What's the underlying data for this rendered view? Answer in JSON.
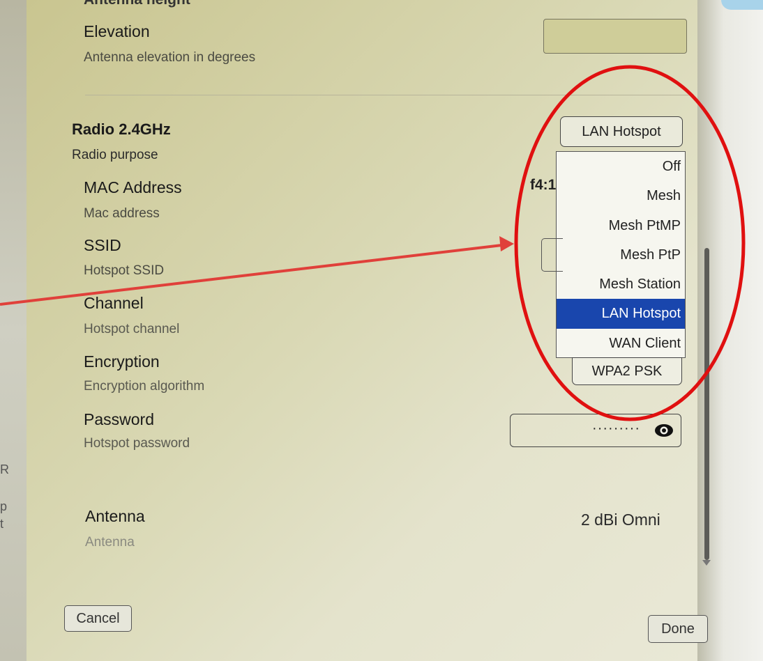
{
  "top_section": {
    "cut_label": "Antenna height",
    "elevation_label": "Elevation",
    "elevation_desc": "Antenna elevation in degrees",
    "elevation_value": ""
  },
  "radio": {
    "title": "Radio 2.4GHz",
    "purpose_desc": "Radio purpose",
    "purpose_selected": "LAN Hotspot",
    "purpose_options": [
      "Off",
      "Mesh",
      "Mesh PtMP",
      "Mesh PtP",
      "Mesh Station",
      "LAN Hotspot",
      "WAN Client"
    ],
    "mac_label": "MAC Address",
    "mac_desc": "Mac address",
    "mac_value": "f4:1",
    "ssid_label": "SSID",
    "ssid_desc": "Hotspot SSID",
    "channel_label": "Channel",
    "channel_desc": "Hotspot channel",
    "encryption_label": "Encryption",
    "encryption_desc": "Encryption algorithm",
    "encryption_value": "WPA2 PSK",
    "password_label": "Password",
    "password_desc": "Hotspot password",
    "password_value": "·········",
    "antenna_label": "Antenna",
    "antenna_desc": "Antenna",
    "antenna_value": "2 dBi Omni"
  },
  "footer": {
    "cancel_label": "Cancel",
    "done_label": "Done"
  },
  "left_edge": [
    "R",
    "p",
    "t"
  ],
  "annotation": {
    "circle_color": "#e01010",
    "arrow_color": "#e0403a"
  },
  "colors": {
    "selected_option_bg": "#1946ad",
    "panel_bg": "#d9d8b4"
  }
}
